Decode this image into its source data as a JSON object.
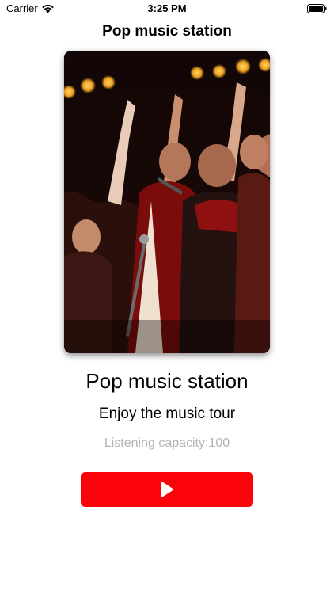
{
  "status_bar": {
    "carrier": "Carrier",
    "time": "3:25 PM",
    "wifi_icon": "wifi-icon",
    "battery_icon": "battery-icon"
  },
  "nav": {
    "title": "Pop music station"
  },
  "artwork": {
    "description_icon": "concert-photo"
  },
  "station": {
    "name": "Pop music station",
    "tagline": "Enjoy the music tour",
    "capacity_label": "Listening capacity:",
    "capacity_value": "100"
  },
  "play_button": {
    "icon": "play-icon",
    "color": "#fa0309"
  }
}
